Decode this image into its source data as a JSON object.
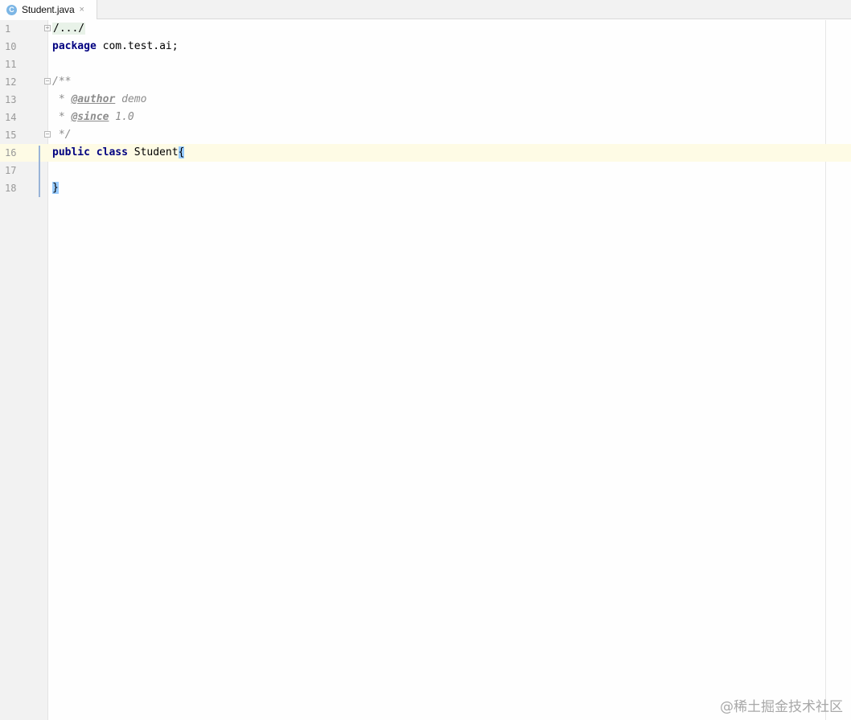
{
  "tab": {
    "label": "Student.java",
    "icon": "java-class-icon",
    "icon_letter": "C",
    "close": "×"
  },
  "lines": [
    {
      "num": "1",
      "fold": true,
      "folded_text": "/.../"
    },
    {
      "num": "10",
      "keyword": "package",
      "text": " com.test.ai;"
    },
    {
      "num": "11"
    },
    {
      "num": "12",
      "fold": true,
      "comment": "/**"
    },
    {
      "num": "13",
      "comment_pre": " * ",
      "tag": "@author",
      "comment_post": " demo"
    },
    {
      "num": "14",
      "comment_pre": " * ",
      "tag": "@since",
      "comment_post": " 1.0"
    },
    {
      "num": "15",
      "fold": true,
      "comment": " */"
    },
    {
      "num": "16",
      "keyword": "public class",
      "text": " Student",
      "brace": "{"
    },
    {
      "num": "17"
    },
    {
      "num": "18",
      "brace": "}"
    }
  ],
  "current_line": "16",
  "watermark": "@稀土掘金技术社区",
  "colors": {
    "keyword": "#000080",
    "comment": "#8c8c8c",
    "current_line_bg": "#fefbe5",
    "brace_match": "#99ccff"
  }
}
